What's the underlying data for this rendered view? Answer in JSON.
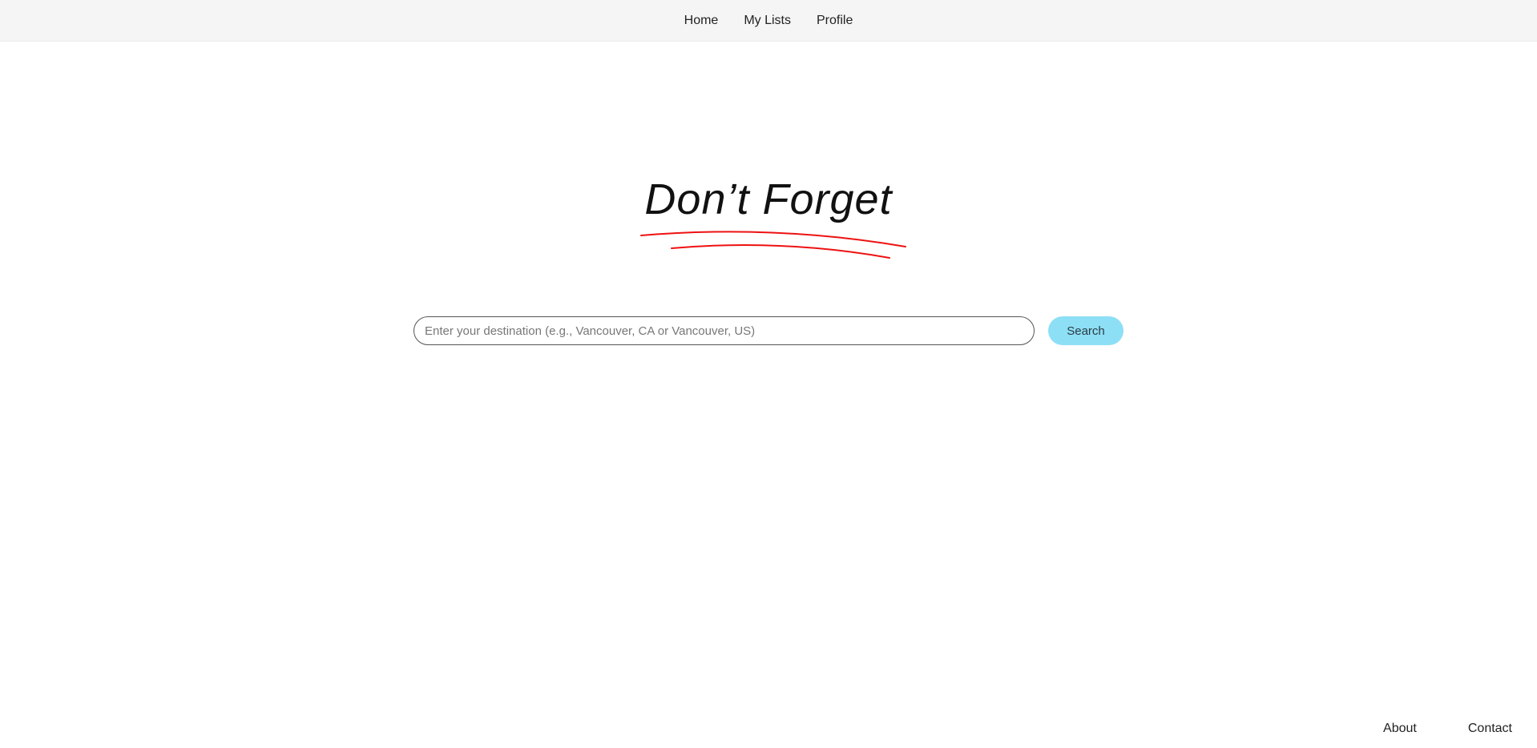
{
  "nav": {
    "items": [
      {
        "label": "Home"
      },
      {
        "label": "My Lists"
      },
      {
        "label": "Profile"
      }
    ]
  },
  "hero": {
    "title": "Don’t Forget",
    "accent_color": "#ee1111"
  },
  "search": {
    "placeholder": "Enter your destination (e.g., Vancouver, CA or Vancouver, US)",
    "value": "",
    "button_label": "Search",
    "button_color": "#8ddff5"
  },
  "footer": {
    "links": [
      {
        "label": "About"
      },
      {
        "label": "Contact"
      }
    ]
  }
}
